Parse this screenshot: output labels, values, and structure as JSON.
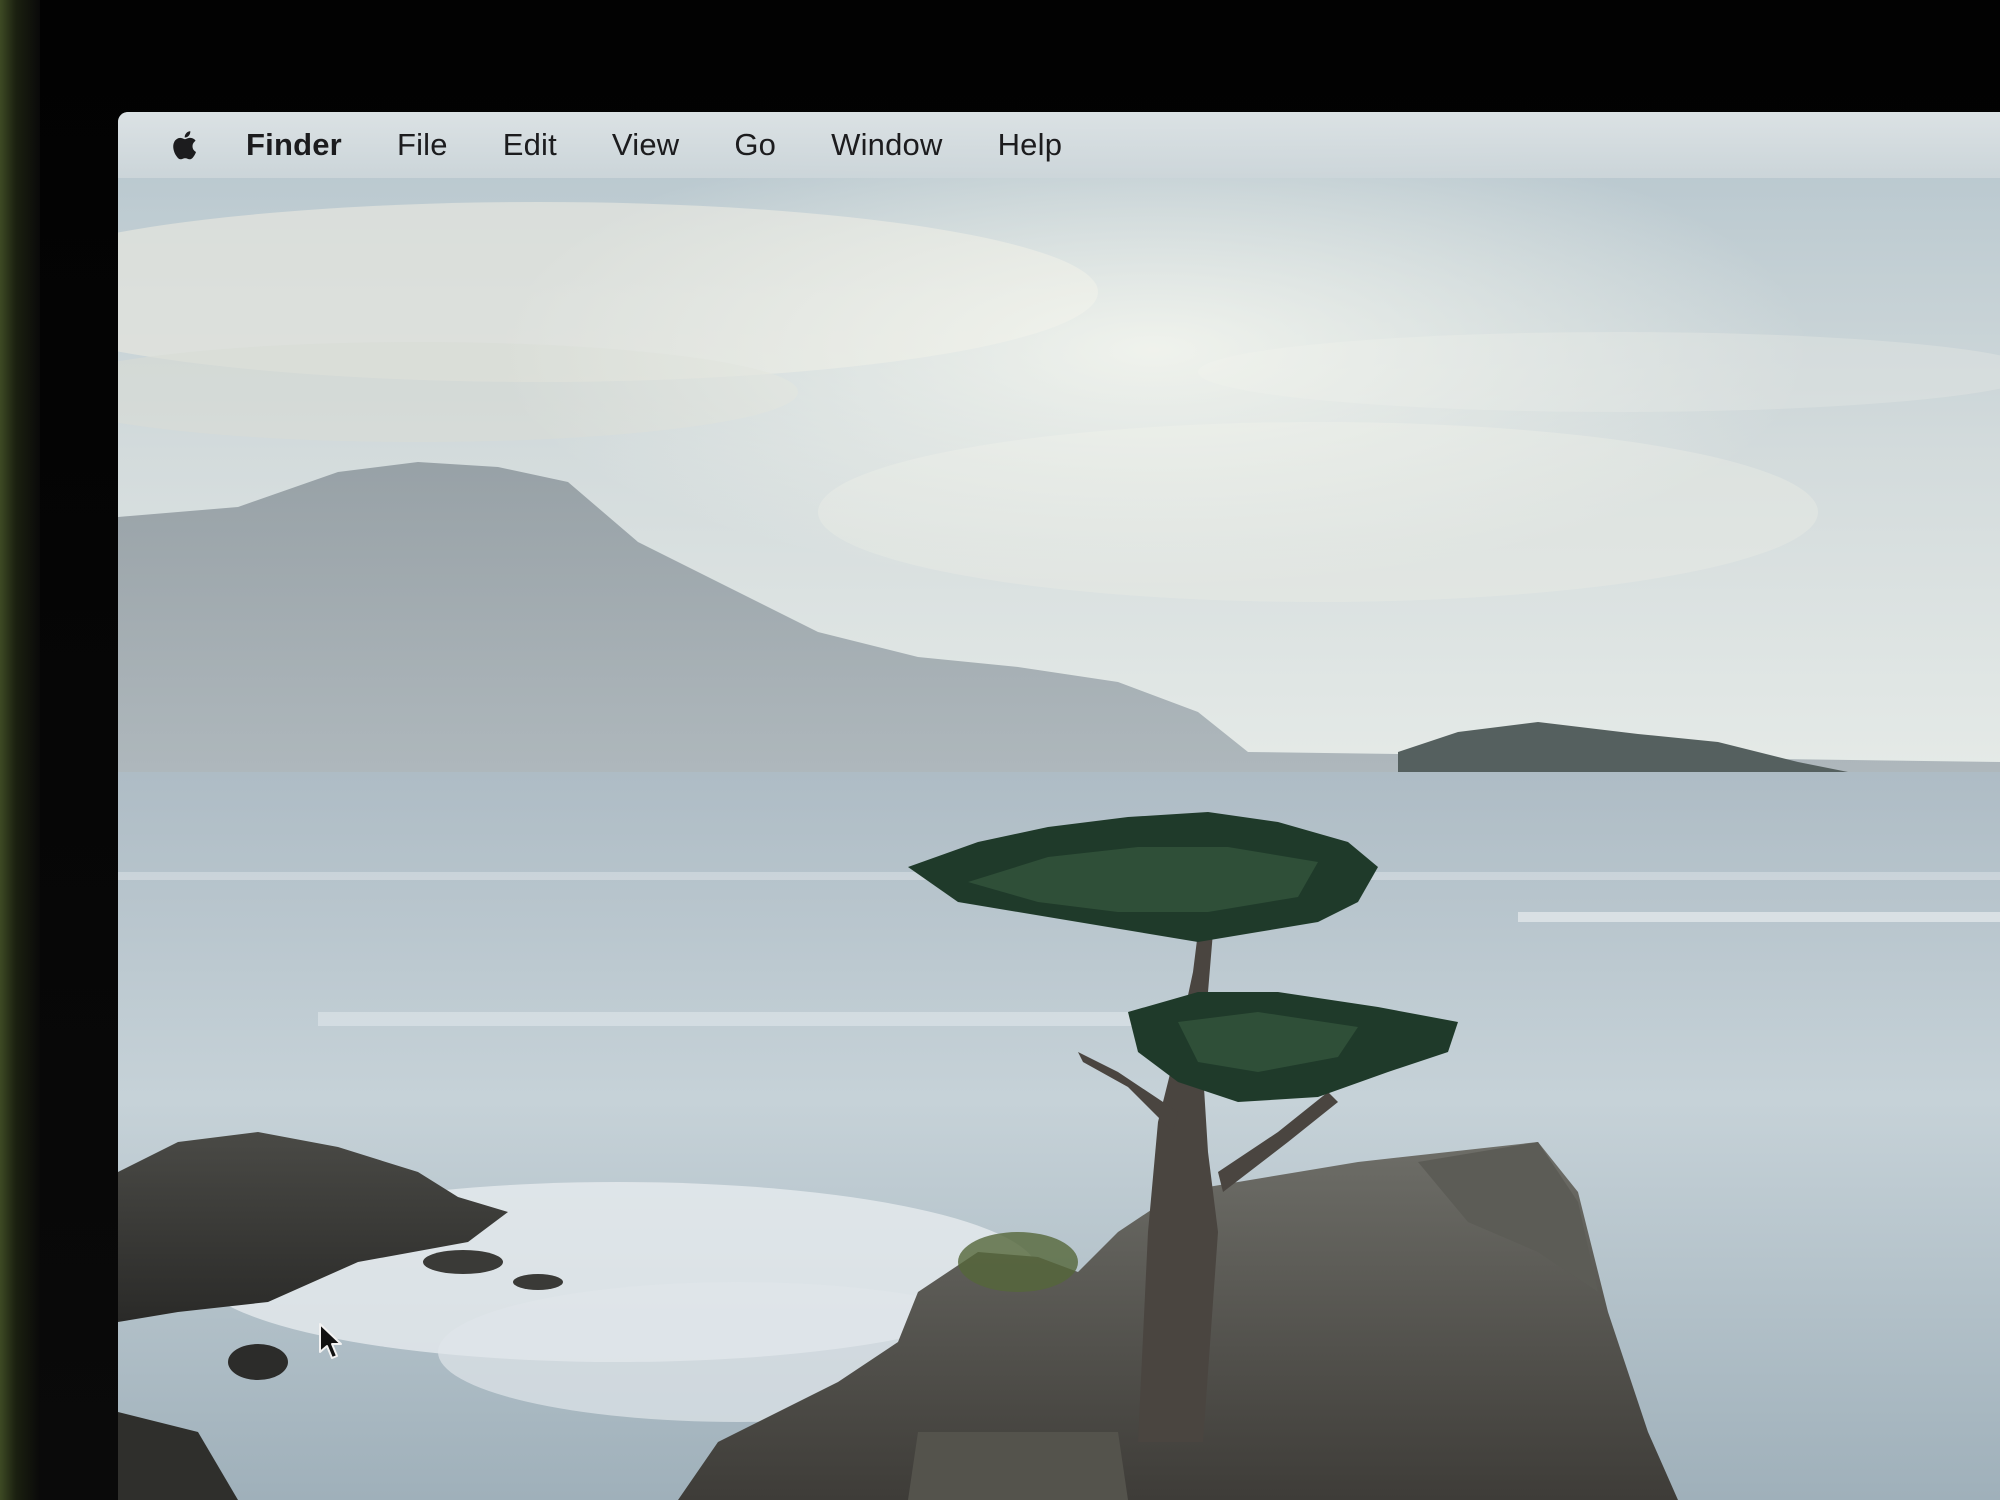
{
  "menubar": {
    "apple_icon": "apple-logo-icon",
    "app_name": "Finder",
    "items": [
      {
        "label": "File"
      },
      {
        "label": "Edit"
      },
      {
        "label": "View"
      },
      {
        "label": "Go"
      },
      {
        "label": "Window"
      },
      {
        "label": "Help"
      }
    ]
  },
  "desktop": {
    "wallpaper": "coastal-cypress-tree-wallpaper",
    "cursor_icon": "pointer-cursor-icon"
  },
  "colors": {
    "menubar_bg": "#d6dde0",
    "menu_text": "#1c1c1e",
    "sea": "#b9c7cf",
    "sky": "#c9d4da"
  }
}
